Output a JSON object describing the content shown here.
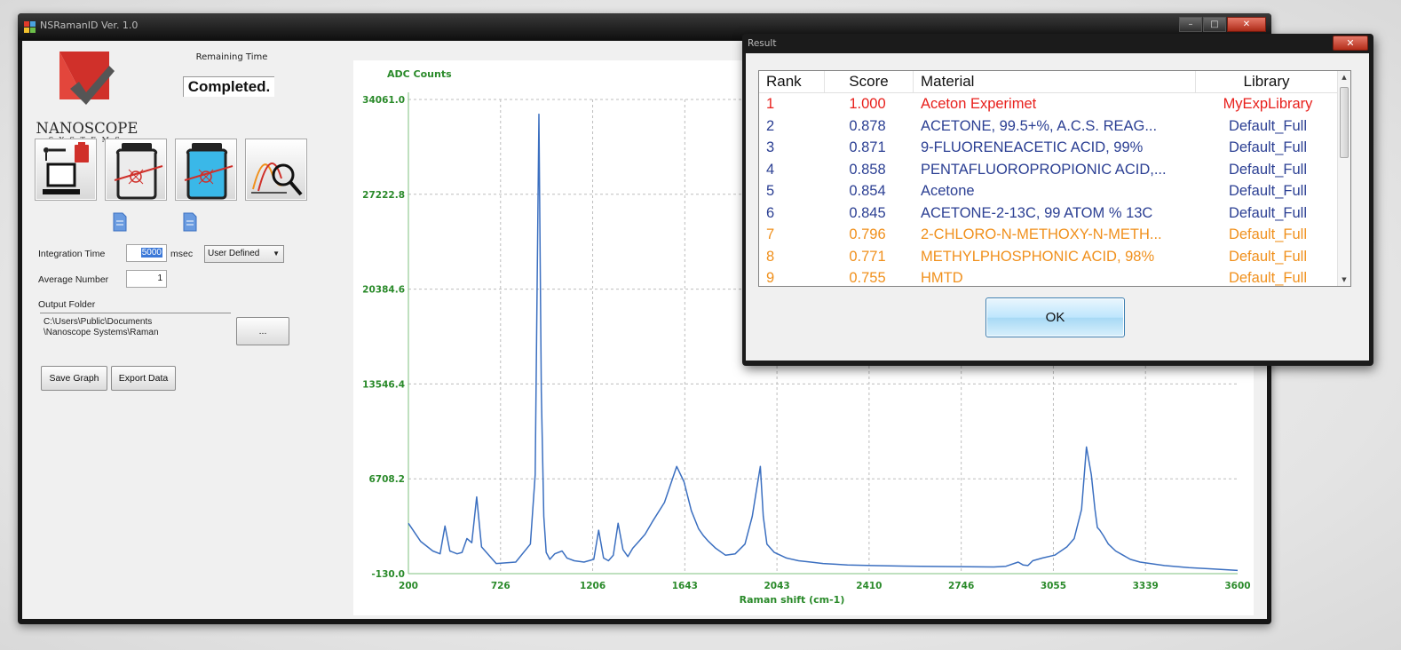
{
  "window": {
    "title": "NSRamanID Ver. 1.0",
    "min_glyph": "–",
    "max_glyph": "□",
    "close_glyph": "✕"
  },
  "logo": {
    "name": "NANOSCOPE",
    "sub": "SYSTEMS"
  },
  "status": {
    "label": "Remaining Time",
    "value": "Completed."
  },
  "controls": {
    "integration_label": "Integration Time",
    "integration_value": "5000",
    "integration_unit": "msec",
    "mode_value": "User Defined",
    "average_label": "Average Number",
    "average_value": "1",
    "output_label": "Output Folder",
    "output_path_line1": "C:\\Users\\Public\\Documents",
    "output_path_line2": "\\Nanoscope Systems\\Raman",
    "browse_label": "...",
    "save_graph_label": "Save Graph",
    "export_data_label": "Export Data"
  },
  "chart_data": {
    "type": "line",
    "title": "",
    "ylabel": "ADC Counts",
    "xlabel": "Raman shift (cm-1)",
    "xlim": [
      200,
      3600
    ],
    "ylim": [
      -130.0,
      34061.0
    ],
    "x_ticks": [
      "200",
      "726",
      "1206",
      "1643",
      "2043",
      "2410",
      "2746",
      "3055",
      "3339",
      "3600"
    ],
    "y_ticks": [
      "34061.0",
      "27222.8",
      "20384.6",
      "13546.4",
      "6708.2",
      "-130.0"
    ],
    "grid": true,
    "color": "#3b6fc0",
    "x": [
      200,
      250,
      300,
      330,
      350,
      370,
      400,
      420,
      440,
      460,
      480,
      500,
      560,
      640,
      700,
      720,
      735,
      745,
      755,
      765,
      780,
      800,
      830,
      850,
      880,
      920,
      960,
      980,
      1000,
      1020,
      1040,
      1060,
      1080,
      1100,
      1120,
      1140,
      1170,
      1200,
      1250,
      1300,
      1330,
      1360,
      1390,
      1410,
      1430,
      1460,
      1500,
      1540,
      1580,
      1610,
      1630,
      1643,
      1655,
      1670,
      1700,
      1750,
      1800,
      1850,
      1900,
      1950,
      2000,
      2100,
      2200,
      2300,
      2400,
      2500,
      2600,
      2650,
      2700,
      2720,
      2740,
      2760,
      2800,
      2850,
      2900,
      2930,
      2960,
      2980,
      3000,
      3015,
      3025,
      3035,
      3050,
      3070,
      3100,
      3130,
      3160,
      3200,
      3300,
      3400,
      3500,
      3600
    ],
    "y": [
      3500,
      2200,
      1500,
      1300,
      3300,
      1500,
      1300,
      1400,
      2400,
      2100,
      5400,
      1800,
      600,
      700,
      2000,
      7000,
      33000,
      13000,
      4000,
      1400,
      900,
      1300,
      1500,
      1000,
      800,
      700,
      900,
      3000,
      1000,
      800,
      1200,
      3500,
      1600,
      1100,
      1700,
      2100,
      2700,
      3600,
      5000,
      7600,
      6500,
      4400,
      3100,
      2600,
      2200,
      1700,
      1200,
      1300,
      2000,
      4000,
      6200,
      7600,
      4000,
      2000,
      1400,
      1000,
      800,
      700,
      600,
      550,
      500,
      450,
      420,
      400,
      380,
      360,
      350,
      400,
      700,
      500,
      450,
      800,
      1000,
      1200,
      1800,
      2400,
      4500,
      9000,
      7000,
      4500,
      3200,
      3000,
      2600,
      2000,
      1500,
      1200,
      900,
      700,
      450,
      300,
      200,
      100
    ]
  },
  "result": {
    "title": "Result",
    "close_glyph": "✕",
    "columns": [
      "Rank",
      "Score",
      "Material",
      "Library"
    ],
    "rows": [
      {
        "rank": "1",
        "score": "1.000",
        "material": "Aceton Experimet",
        "library": "MyExpLibrary",
        "color": "#e8201c"
      },
      {
        "rank": "2",
        "score": "0.878",
        "material": "ACETONE, 99.5+%, A.C.S. REAG...",
        "library": "Default_Full",
        "color": "#2b3f93"
      },
      {
        "rank": "3",
        "score": "0.871",
        "material": "9-FLUORENEACETIC ACID, 99%",
        "library": "Default_Full",
        "color": "#2b3f93"
      },
      {
        "rank": "4",
        "score": "0.858",
        "material": "PENTAFLUOROPROPIONIC ACID,...",
        "library": "Default_Full",
        "color": "#2b3f93"
      },
      {
        "rank": "5",
        "score": "0.854",
        "material": "Acetone",
        "library": "Default_Full",
        "color": "#2b3f93"
      },
      {
        "rank": "6",
        "score": "0.845",
        "material": "ACETONE-2-13C, 99 ATOM % 13C",
        "library": "Default_Full",
        "color": "#2b3f93"
      },
      {
        "rank": "7",
        "score": "0.796",
        "material": "2-CHLORO-N-METHOXY-N-METH...",
        "library": "Default_Full",
        "color": "#f0901c"
      },
      {
        "rank": "8",
        "score": "0.771",
        "material": "METHYLPHOSPHONIC ACID, 98%",
        "library": "Default_Full",
        "color": "#f0901c"
      },
      {
        "rank": "9",
        "score": "0.755",
        "material": "HMTD",
        "library": "Default_Full",
        "color": "#f0901c"
      }
    ],
    "ok_label": "OK"
  }
}
